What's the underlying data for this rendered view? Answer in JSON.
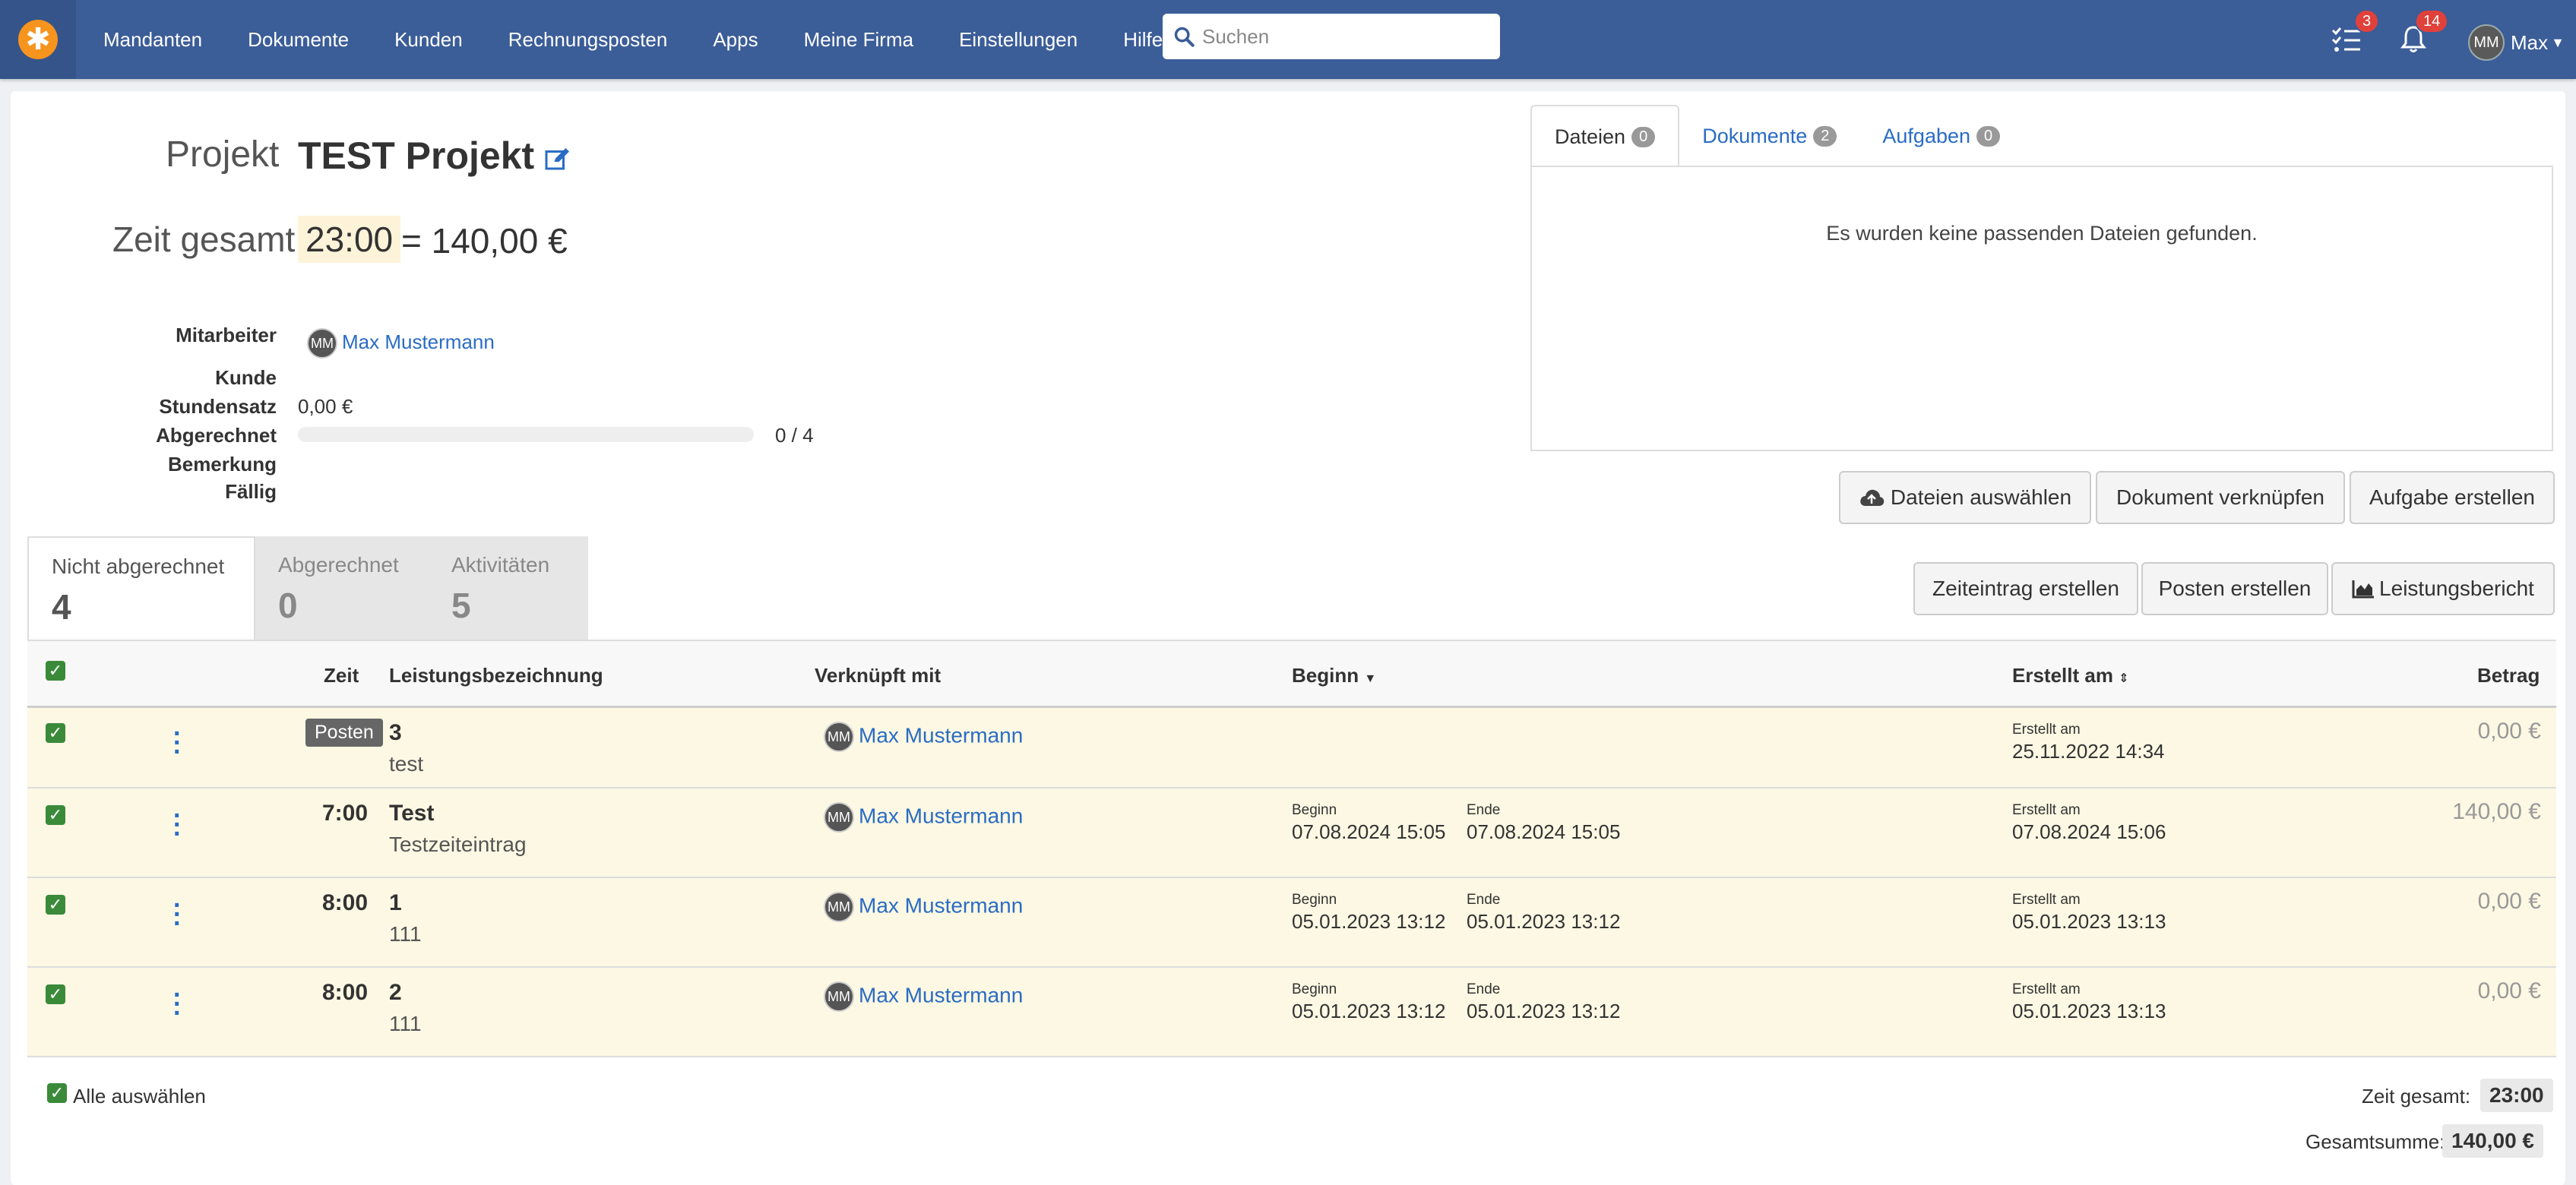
{
  "nav": {
    "items": [
      "Mandanten",
      "Dokumente",
      "Kunden",
      "Rechnungsposten",
      "Apps",
      "Meine Firma",
      "Einstellungen",
      "Hilfe?"
    ],
    "search_placeholder": "Suchen",
    "tasks_badge": "3",
    "notifications_badge": "14",
    "user_initials": "MM",
    "user_name": "Max"
  },
  "project": {
    "label": "Projekt",
    "title": "TEST Projekt",
    "time_label": "Zeit gesamt",
    "time_value": "23:00",
    "time_equals": "= 140,00 €"
  },
  "meta": {
    "mitarbeiter_label": "Mitarbeiter",
    "mitarbeiter_initials": "MM",
    "mitarbeiter_name": "Max Mustermann",
    "kunde_label": "Kunde",
    "stundensatz_label": "Stundensatz",
    "stundensatz_value": "0,00 €",
    "abgerechnet_label": "Abgerechnet",
    "abgerechnet_value": "0 / 4",
    "abgerechnet_progress": 0,
    "bemerkung_label": "Bemerkung",
    "faellig_label": "Fällig"
  },
  "right_tabs": [
    {
      "label": "Dateien",
      "count": "0"
    },
    {
      "label": "Dokumente",
      "count": "2"
    },
    {
      "label": "Aufgaben",
      "count": "0"
    }
  ],
  "files_empty": "Es wurden keine passenden Dateien gefunden.",
  "buttons": {
    "dateien_auswaehlen": "Dateien auswählen",
    "dokument_verknuepfen": "Dokument verknüpfen",
    "aufgabe_erstellen": "Aufgabe erstellen",
    "zeiteintrag_erstellen": "Zeiteintrag erstellen",
    "posten_erstellen": "Posten erstellen",
    "leistungsbericht": "Leistungsbericht"
  },
  "left_tabs": [
    {
      "label": "Nicht abgerechnet",
      "count": "4"
    },
    {
      "label": "Abgerechnet",
      "count": "0"
    },
    {
      "label": "Aktivitäten",
      "count": "5"
    }
  ],
  "table": {
    "headers": {
      "zeit": "Zeit",
      "leistung": "Leistungsbezeichnung",
      "verknuepft": "Verknüpft mit",
      "beginn": "Beginn",
      "erstellt": "Erstellt am",
      "betrag": "Betrag"
    },
    "rows": [
      {
        "time": "",
        "tag": "Posten",
        "title": "3",
        "sub": "test",
        "user_initials": "MM",
        "user": "Max Mustermann",
        "begin_label": "",
        "begin": "",
        "end_label": "",
        "end": "",
        "created_label": "Erstellt am",
        "created": "25.11.2022 14:34",
        "amount": "0,00 €"
      },
      {
        "time": "7:00",
        "tag": "",
        "title": "Test",
        "sub": "Testzeiteintrag",
        "user_initials": "MM",
        "user": "Max Mustermann",
        "begin_label": "Beginn",
        "begin": "07.08.2024 15:05",
        "end_label": "Ende",
        "end": "07.08.2024 15:05",
        "created_label": "Erstellt am",
        "created": "07.08.2024 15:06",
        "amount": "140,00 €"
      },
      {
        "time": "8:00",
        "tag": "",
        "title": "1",
        "sub": "111",
        "user_initials": "MM",
        "user": "Max Mustermann",
        "begin_label": "Beginn",
        "begin": "05.01.2023 13:12",
        "end_label": "Ende",
        "end": "05.01.2023 13:12",
        "created_label": "Erstellt am",
        "created": "05.01.2023 13:13",
        "amount": "0,00 €"
      },
      {
        "time": "8:00",
        "tag": "",
        "title": "2",
        "sub": "111",
        "user_initials": "MM",
        "user": "Max Mustermann",
        "begin_label": "Beginn",
        "begin": "05.01.2023 13:12",
        "end_label": "Ende",
        "end": "05.01.2023 13:12",
        "created_label": "Erstellt am",
        "created": "05.01.2023 13:13",
        "amount": "0,00 €"
      }
    ]
  },
  "footer": {
    "select_all": "Alle auswählen",
    "zeit_gesamt_label": "Zeit gesamt:",
    "zeit_gesamt_value": "23:00",
    "gesamtsumme_label": "Gesamtsumme:",
    "gesamtsumme_value": "140,00 €"
  },
  "colors": {
    "navbar": "#3b5d98",
    "brand": "#f7941d",
    "link": "#2a6cc4",
    "row_highlight": "#fcf8e3",
    "checkbox": "#3a8a3a",
    "badge": "#e0413b"
  }
}
